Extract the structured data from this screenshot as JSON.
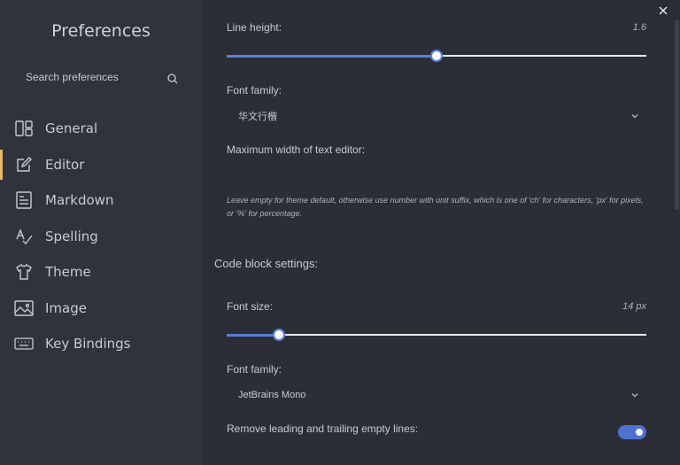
{
  "sidebar": {
    "title": "Preferences",
    "search_placeholder": "Search preferences",
    "items": [
      {
        "label": "General",
        "icon": "general-icon"
      },
      {
        "label": "Editor",
        "icon": "editor-icon",
        "active": true
      },
      {
        "label": "Markdown",
        "icon": "markdown-icon"
      },
      {
        "label": "Spelling",
        "icon": "spelling-icon"
      },
      {
        "label": "Theme",
        "icon": "theme-icon"
      },
      {
        "label": "Image",
        "icon": "image-icon"
      },
      {
        "label": "Key Bindings",
        "icon": "keyboard-icon"
      }
    ]
  },
  "editor": {
    "line_height": {
      "label": "Line height:",
      "value": "1.6",
      "fraction": 0.5
    },
    "font_family": {
      "label": "Font family:",
      "value": "华文行楷"
    },
    "max_width": {
      "label": "Maximum width of text editor:",
      "value": "",
      "hint": "Leave empty for theme default, otherwise use number with unit suffix, which is one of 'ch' for characters, 'px' for pixels, or '%' for percentage."
    }
  },
  "code_block": {
    "title": "Code block settings:",
    "font_size": {
      "label": "Font size:",
      "value": "14 px",
      "fraction": 0.125
    },
    "font_family": {
      "label": "Font family:",
      "value": "JetBrains Mono"
    },
    "trim_lines": {
      "label": "Remove leading and trailing empty lines:",
      "enabled": true
    }
  },
  "colors": {
    "accent": "#5a7fd8",
    "active_indicator": "#e7b66b",
    "sidebar_bg": "#30333b",
    "main_bg": "#2b2e36"
  }
}
